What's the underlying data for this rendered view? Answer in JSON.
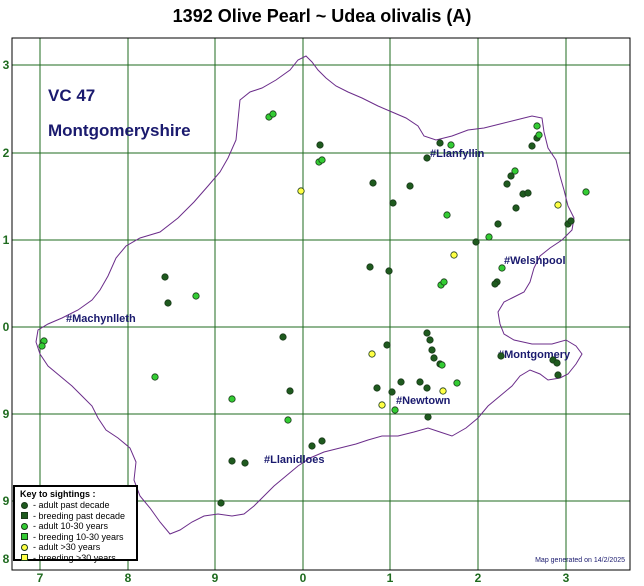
{
  "title": "1392 Olive Pearl ~ Udea olivalis (A)",
  "region": {
    "code": "VC 47",
    "name": "Montgomeryshire"
  },
  "grid": {
    "x_labels": [
      "7",
      "8",
      "9",
      "0",
      "1",
      "2",
      "3"
    ],
    "y_labels": [
      "3",
      "2",
      "1",
      "0",
      "9",
      "9",
      "8"
    ]
  },
  "places": [
    {
      "name": "#Llanfyllin"
    },
    {
      "name": "#Welshpool"
    },
    {
      "name": "#Machynlleth"
    },
    {
      "name": "#Montgomery"
    },
    {
      "name": "#Newtown"
    },
    {
      "name": "#Llanidloes"
    }
  ],
  "legend": {
    "heading": "Key to sightings :",
    "items": [
      {
        "label": "- adult past decade",
        "shape": "circle",
        "color": "#1e5a1e"
      },
      {
        "label": "- breeding past decade",
        "shape": "square",
        "color": "#1e5a1e"
      },
      {
        "label": "- adult 10-30 years",
        "shape": "circle",
        "color": "#33cc33"
      },
      {
        "label": "- breeding 10-30 years",
        "shape": "square",
        "color": "#33cc33"
      },
      {
        "label": "- adult >30 years",
        "shape": "circle",
        "color": "#ffff44"
      },
      {
        "label": "- breeding >30 years",
        "shape": "square",
        "color": "#ffff44"
      }
    ]
  },
  "footer": "Map generated on 14/2/2025",
  "colors": {
    "grid": "#1f6b1f",
    "boundary": "#6b2d8a",
    "text": "#1a1a6e",
    "dark": "#1e5a1e",
    "mid": "#33cc33",
    "old": "#ffff44"
  }
}
